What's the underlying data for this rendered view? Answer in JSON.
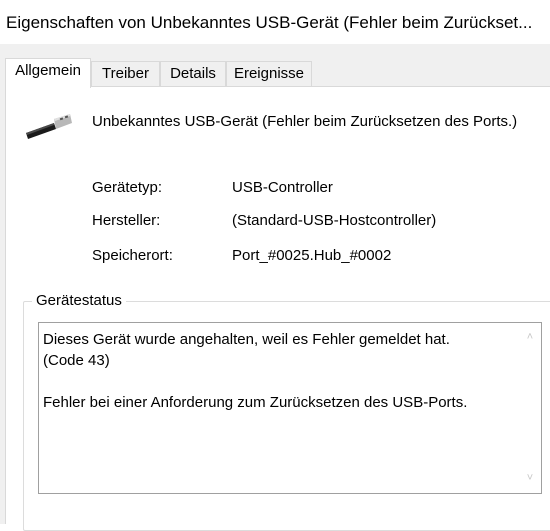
{
  "window": {
    "title": "Eigenschaften von Unbekanntes USB-Gerät (Fehler beim Zurückset..."
  },
  "tabs": [
    {
      "label": "Allgemein",
      "active": true
    },
    {
      "label": "Treiber",
      "active": false
    },
    {
      "label": "Details",
      "active": false
    },
    {
      "label": "Ereignisse",
      "active": false
    }
  ],
  "device": {
    "icon": "usb-plug-icon",
    "name": "Unbekanntes USB-Gerät (Fehler beim Zurücksetzen des Ports.)"
  },
  "properties": [
    {
      "label": "Gerätetyp:",
      "value": "USB-Controller"
    },
    {
      "label": "Hersteller:",
      "value": "(Standard-USB-Hostcontroller)"
    },
    {
      "label": "Speicherort:",
      "value": "Port_#0025.Hub_#0002"
    }
  ],
  "status": {
    "group_label": "Gerätestatus",
    "text": "Dieses Gerät wurde angehalten, weil es Fehler gemeldet hat.\n(Code 43)\n\nFehler bei einer Anforderung zum Zurücksetzen des USB-Ports."
  }
}
